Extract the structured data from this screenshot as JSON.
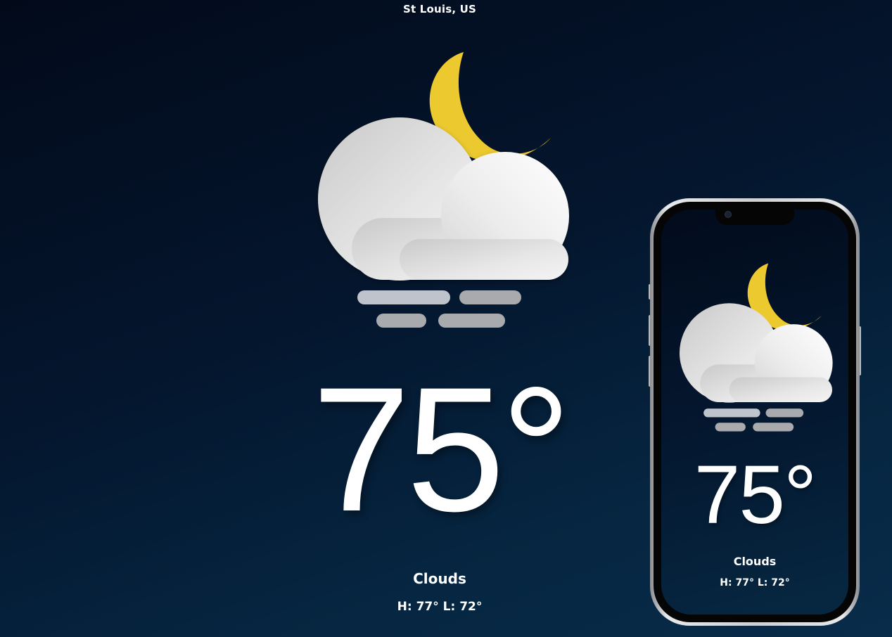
{
  "location": "St Louis, US",
  "weather": {
    "icon": "cloudy-night-fog-icon",
    "temperature": "75°",
    "description": "Clouds",
    "high_low": "H: 77° L: 72°"
  },
  "phone_preview": {
    "icon": "cloudy-night-fog-icon",
    "temperature": "75°",
    "description": "Clouds",
    "high_low": "H: 77° L: 72°"
  },
  "colors": {
    "background_dark": "#020a1a",
    "background_light": "#082c4a",
    "moon": "#ecc92f",
    "cloud": "#e6e6e6",
    "fog_light": "#bfc4cc",
    "fog_dark": "#a8aaad"
  }
}
